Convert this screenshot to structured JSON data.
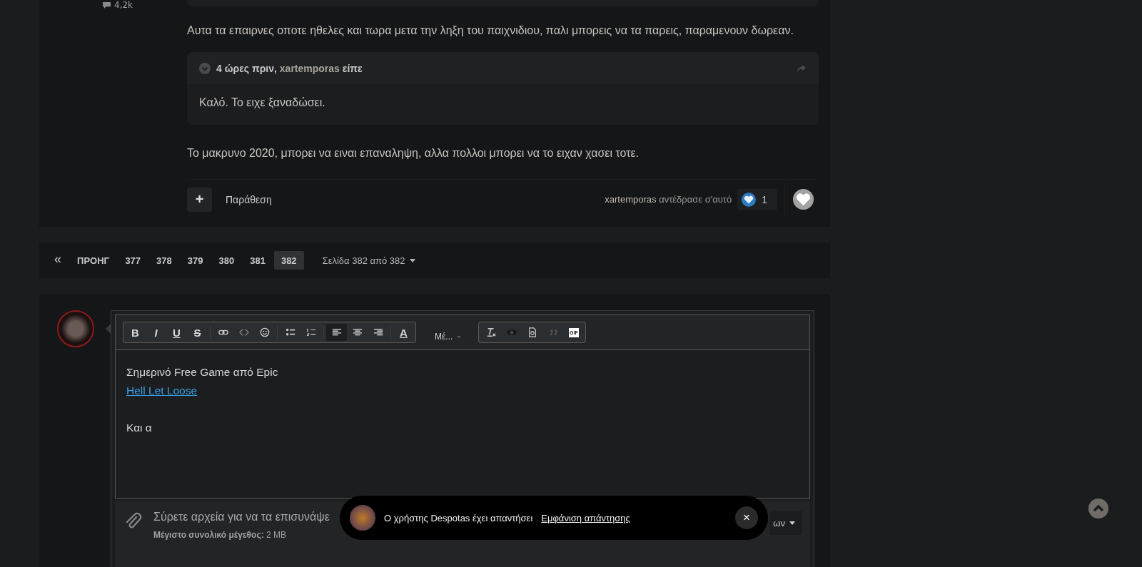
{
  "post_stat": {
    "count": "4,2k"
  },
  "post": {
    "blocks": [
      {
        "kind": "paragraph",
        "text": "Αυτα τα επαιρνες οποτε ηθελες και τωρα μετα την ληξη του παιχνιδιου, παλι μπορεις να τα παρεις, παραμενουν δωρεαν."
      },
      {
        "kind": "quote",
        "time": "4 ώρες πριν,",
        "author": "xartemporas",
        "verb": "είπε",
        "text": "Καλό. Το ειχε ξαναδώσει."
      },
      {
        "kind": "paragraph",
        "text": "Το μακρυνο 2020, μπορει να ειναι επαναληψη, αλλα πολλοι μπορει να το ειχαν χασει τοτε."
      }
    ]
  },
  "actions": {
    "add": "+",
    "quote_button": "Παράθεση",
    "reactor": "xartemporas",
    "reaction_text": "αντέδρασε σ'αυτό",
    "reaction_count": "1"
  },
  "pagination": {
    "first": "«",
    "prev": "ΠΡΟΗΓ",
    "pages": [
      {
        "label": "377",
        "selected": false
      },
      {
        "label": "378",
        "selected": false
      },
      {
        "label": "379",
        "selected": false
      },
      {
        "label": "380",
        "selected": false
      },
      {
        "label": "381",
        "selected": false
      },
      {
        "label": "382",
        "selected": true
      }
    ],
    "page_info": "Σελίδα 382 από 382"
  },
  "editor": {
    "toolbar_groups": [
      [
        {
          "kind": "bold",
          "label": "B",
          "selected": false
        },
        {
          "kind": "italic",
          "label": "I",
          "selected": false
        },
        {
          "kind": "underline",
          "label": "U",
          "selected": false
        },
        {
          "kind": "strike",
          "label": "S",
          "selected": false
        },
        {
          "kind": "link",
          "selected": false
        },
        {
          "kind": "code",
          "selected": false
        },
        {
          "kind": "emoji",
          "selected": false
        },
        {
          "kind": "bullets",
          "selected": false
        },
        {
          "kind": "numbers",
          "selected": false
        },
        {
          "kind": "align-left",
          "selected": true
        },
        {
          "kind": "align-center",
          "selected": false
        },
        {
          "kind": "align-right",
          "selected": false
        },
        {
          "kind": "color",
          "label": "A",
          "selected": false
        }
      ],
      [
        {
          "kind": "clear",
          "selected": false
        },
        {
          "kind": "preview",
          "selected": false
        },
        {
          "kind": "source",
          "selected": false
        },
        {
          "kind": "quote",
          "selected": false
        },
        {
          "kind": "gif",
          "label": "GIF",
          "selected": false
        }
      ]
    ],
    "format_label": "Μέ...",
    "paragraphs": [
      [
        {
          "kind": "text",
          "text": "Σημερινό Free Game από Epic"
        },
        {
          "kind": "link",
          "text": "Hell Let Loose"
        }
      ],
      [
        {
          "kind": "text",
          "text": "Και α"
        }
      ]
    ],
    "attach_text": "Σύρετε αρχεία για να τα επισυνάψε",
    "max_size_label": "Μέγιστο συνολικό μέγεθος:",
    "max_size": "2 MB",
    "insert_media": "ων"
  },
  "toast": {
    "message": "Ο χρήστης Despotas έχει απαντήσει",
    "link": "Εμφάνιση απάντησης",
    "close": "×"
  }
}
